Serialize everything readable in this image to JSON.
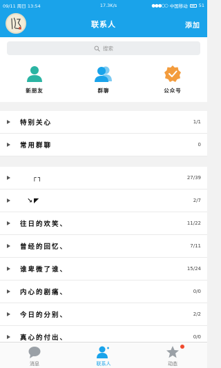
{
  "status_bar": {
    "datetime": "09/11 周日 13:54",
    "network_speed": "17.3K/s",
    "signal_dots": "●●●○○",
    "carrier": "中国移动",
    "battery": "51"
  },
  "header": {
    "title": "联系人",
    "add_label": "添加"
  },
  "search": {
    "placeholder": "搜索"
  },
  "quick_actions": [
    {
      "label": "新朋友",
      "icon": "add-friend-icon",
      "color": "#2bb4a3"
    },
    {
      "label": "群聊",
      "icon": "group-chat-icon",
      "color": "#1aa3ea"
    },
    {
      "label": "公众号",
      "icon": "official-account-icon",
      "color": "#f39c3d"
    }
  ],
  "groups_top": [
    {
      "name": "特别关心",
      "count": "1/1"
    },
    {
      "name": "常用群聊",
      "count": "0"
    }
  ],
  "groups_main": [
    {
      "name": "┌┐",
      "count": "27/39"
    },
    {
      "name": "↘◤",
      "count": "2/7"
    },
    {
      "name": "往日的欢笑、",
      "count": "11/22"
    },
    {
      "name": "曾经的回忆、",
      "count": "7/11"
    },
    {
      "name": "谁卑微了谁、",
      "count": "15/24"
    },
    {
      "name": "内心的剧痛、",
      "count": "0/0"
    },
    {
      "name": "今日的分别、",
      "count": "2/2"
    },
    {
      "name": "真心的付出、",
      "count": "0/0"
    }
  ],
  "tabs": [
    {
      "label": "消息",
      "icon": "message-icon",
      "active": false
    },
    {
      "label": "联系人",
      "icon": "contacts-icon",
      "active": true
    },
    {
      "label": "动态",
      "icon": "star-icon",
      "active": false
    }
  ],
  "colors": {
    "primary": "#1aa3ea",
    "badge": "#f04a2e"
  }
}
